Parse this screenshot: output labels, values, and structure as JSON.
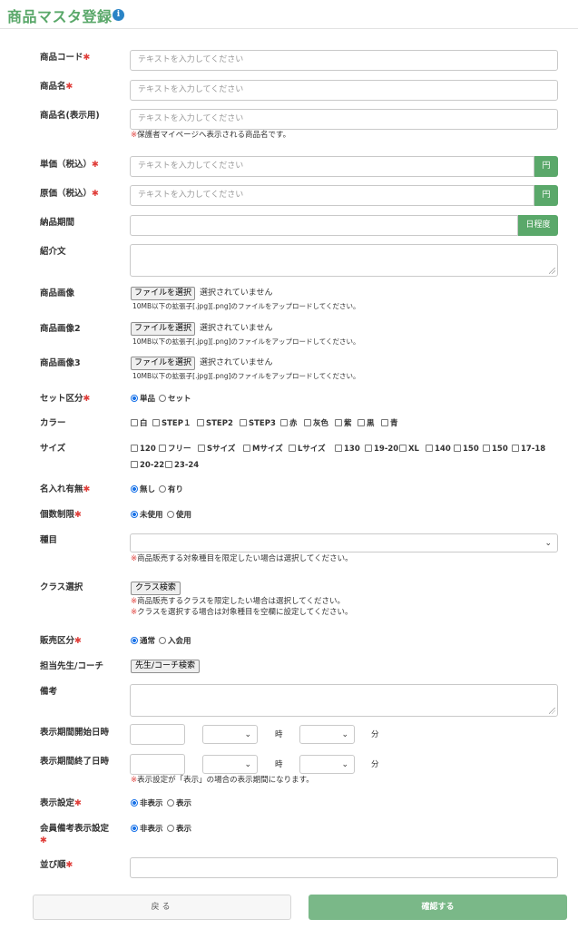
{
  "page": {
    "title": "商品マスタ登録",
    "info_icon": "i"
  },
  "placeholder": "テキストを入力してください",
  "labels": {
    "code": "商品コード",
    "name": "商品名",
    "display_name": "商品名(表示用)",
    "unit_price": "単価（税込）",
    "cost_price": "原価（税込）",
    "delivery": "納品期間",
    "intro": "紹介文",
    "image1": "商品画像",
    "image2": "商品画像2",
    "image3": "商品画像3",
    "set_type": "セット区分",
    "color": "カラー",
    "size": "サイズ",
    "name_entry": "名入れ有無",
    "qty_limit": "個数制限",
    "category": "種目",
    "class_select": "クラス選択",
    "sales_type": "販売区分",
    "teacher": "担当先生/コーチ",
    "remarks": "備考",
    "disp_start": "表示期間開始日時",
    "disp_end": "表示期間終了日時",
    "disp_setting": "表示設定",
    "member_remarks": "会員備考表示設定",
    "order": "並び順"
  },
  "required_mark": "✱",
  "notes": {
    "display_name": "保護者マイページへ表示される商品名です。",
    "category": "商品販売する対象種目を限定したい場合は選択してください。",
    "class1": "商品販売するクラスを限定したい場合は選択してください。",
    "class2": "クラスを選択する場合は対象種目を空欄に設定してください。",
    "disp_end": "表示設定が「表示」の場合の表示期間になります。",
    "note_mark": "※"
  },
  "addons": {
    "yen": "円",
    "schedule": "日程度"
  },
  "file": {
    "button": "ファイルを選択",
    "status": "選択されていません",
    "hint": "10MB以下の拡張子[.jpg][.png]のファイルをアップロードしてください。"
  },
  "set_type_options": [
    "単品",
    "セット"
  ],
  "colors": [
    "白",
    "STEP１",
    "STEP2",
    "STEP3",
    "赤",
    "灰色",
    "紫",
    "黒",
    "青"
  ],
  "sizes_row1": [
    "120",
    "フリー",
    "Sサイズ",
    "Mサイズ",
    "Lサイズ",
    "130",
    "19-20",
    "XL",
    "140",
    "150",
    "150",
    "17-18"
  ],
  "sizes_row2": [
    "20-22",
    "23-24"
  ],
  "name_entry_options": [
    "無し",
    "有り"
  ],
  "qty_limit_options": [
    "未使用",
    "使用"
  ],
  "class_button": "クラス検索",
  "sales_type_options": [
    "通常",
    "入会用"
  ],
  "teacher_button": "先生/コーチ検索",
  "time_units": {
    "hour": "時",
    "minute": "分"
  },
  "disp_setting_options": [
    "非表示",
    "表示"
  ],
  "member_remarks_options": [
    "非表示",
    "表示"
  ],
  "buttons": {
    "back": "戻る",
    "confirm": "確認する"
  }
}
